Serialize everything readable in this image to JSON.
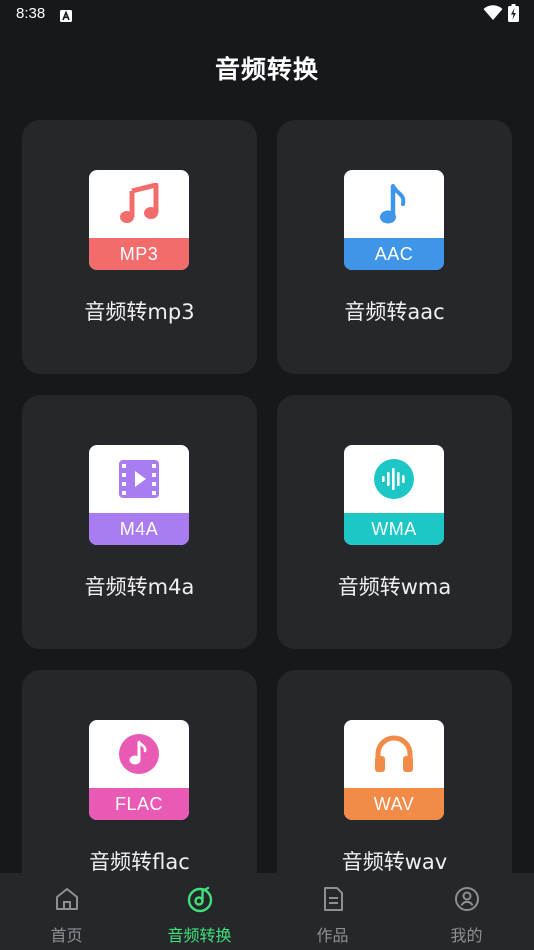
{
  "status_bar": {
    "time": "8:38"
  },
  "header": {
    "title": "音频转换"
  },
  "cards": [
    {
      "label": "音频转mp3",
      "badge": "MP3",
      "icon": "music-note-icon",
      "color": "#f36c6c"
    },
    {
      "label": "音频转aac",
      "badge": "AAC",
      "icon": "eighth-note-icon",
      "color": "#3f95e8"
    },
    {
      "label": "音频转m4a",
      "badge": "M4A",
      "icon": "video-play-icon",
      "color": "#a97cf2"
    },
    {
      "label": "音频转wma",
      "badge": "WMA",
      "icon": "sound-wave-icon",
      "color": "#1cc7c6"
    },
    {
      "label": "音频转flac",
      "badge": "FLAC",
      "icon": "disc-note-icon",
      "color": "#e95ab4"
    },
    {
      "label": "音频转wav",
      "badge": "WAV",
      "icon": "headphones-icon",
      "color": "#f28a48"
    }
  ],
  "bottom_nav": {
    "items": [
      {
        "label": "首页",
        "icon": "home-icon"
      },
      {
        "label": "音频转换",
        "icon": "music-disc-icon",
        "active": true
      },
      {
        "label": "作品",
        "icon": "document-icon"
      },
      {
        "label": "我的",
        "icon": "profile-icon"
      }
    ],
    "active_color": "#3ee07a",
    "inactive_color": "#8e8f93"
  }
}
